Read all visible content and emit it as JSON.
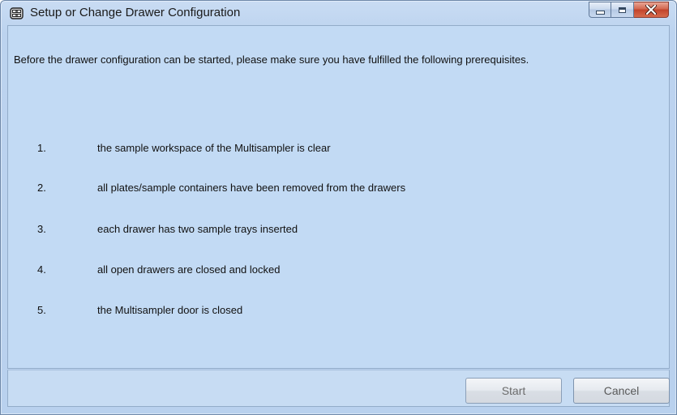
{
  "window": {
    "title": "Setup or Change Drawer Configuration",
    "icon": "drawer-config-icon",
    "controls": {
      "minimize": "minimize-icon",
      "maximize": "maximize-icon",
      "close": "close-icon"
    }
  },
  "content": {
    "intro": "Before the drawer configuration can be started, please make sure you have fulfilled the following prerequisites.",
    "steps": [
      {
        "num": "1.",
        "text": "the sample workspace of the Multisampler is clear"
      },
      {
        "num": "2.",
        "text": "all plates/sample containers have been removed from the drawers"
      },
      {
        "num": "3.",
        "text": "each drawer has two sample trays inserted"
      },
      {
        "num": "4.",
        "text": "all open drawers are closed and locked"
      },
      {
        "num": "5.",
        "text": "the Multisampler door is closed"
      }
    ]
  },
  "footer": {
    "start_label": "Start",
    "cancel_label": "Cancel"
  },
  "colors": {
    "window_bg": "#bcd3ef",
    "panel_bg": "#c2daf4",
    "close_button": "#c2432b"
  }
}
